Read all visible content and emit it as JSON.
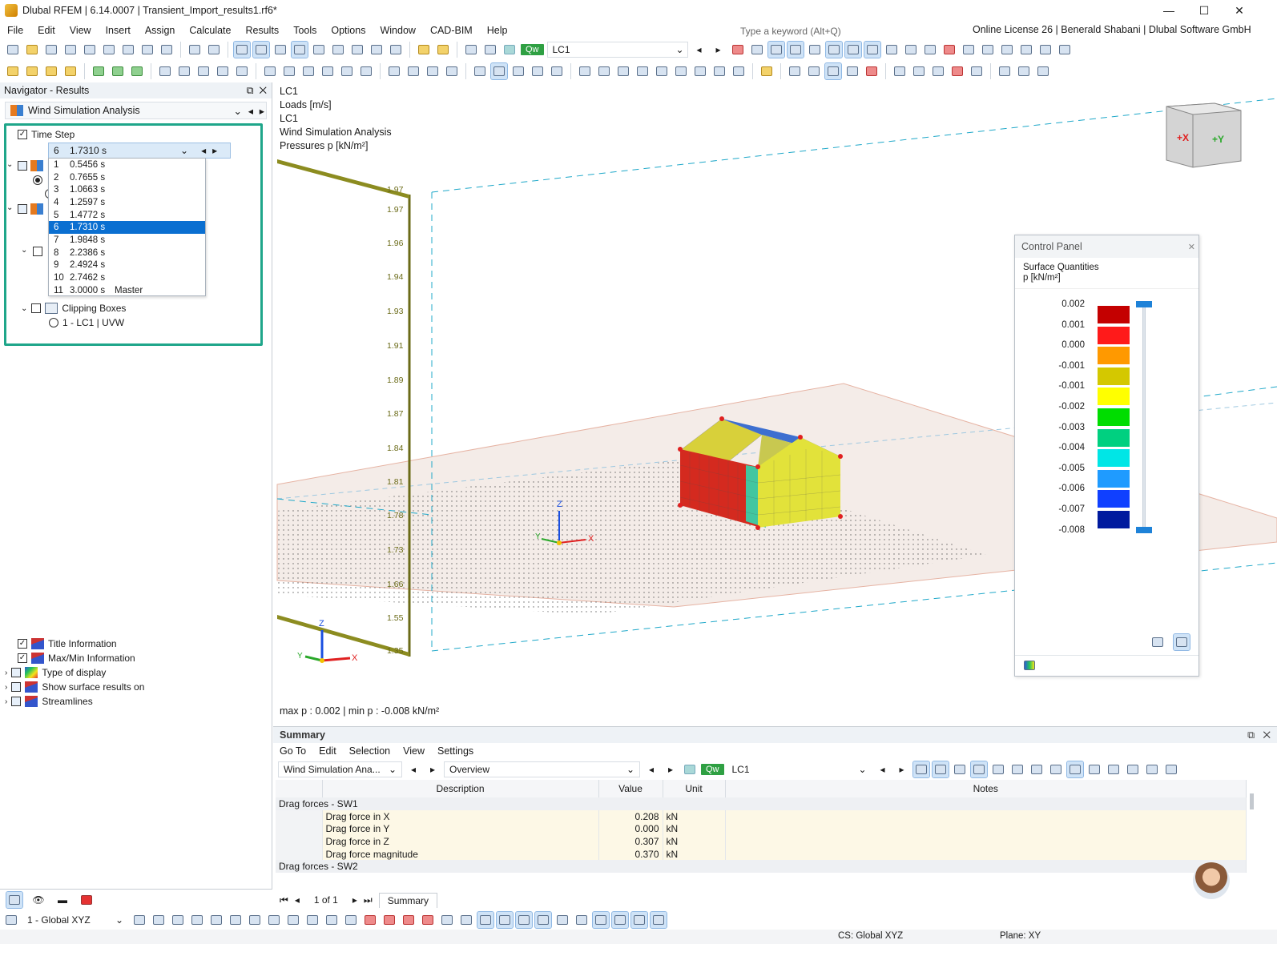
{
  "window": {
    "title": "Dlubal RFEM | 6.14.0007 | Transient_Import_results1.rf6*",
    "minimize": "—",
    "maximize": "☐",
    "close": "✕"
  },
  "menu": [
    "File",
    "Edit",
    "View",
    "Insert",
    "Assign",
    "Calculate",
    "Results",
    "Tools",
    "Options",
    "Window",
    "CAD-BIM",
    "Help"
  ],
  "search": {
    "placeholder": "Type a keyword (Alt+Q)"
  },
  "license": "Online License 26 | Benerald Shabani | Dlubal Software GmbH",
  "loadcase": {
    "tag": "Qw",
    "name": "LC1"
  },
  "navigator": {
    "title": "Navigator - Results",
    "module": "Wind Simulation Analysis",
    "time_step_label": "Time Step",
    "selected_step": {
      "n": "6",
      "v": "1.7310 s"
    },
    "steps": [
      {
        "n": "1",
        "v": "0.5456 s",
        "note": ""
      },
      {
        "n": "2",
        "v": "0.7655 s",
        "note": ""
      },
      {
        "n": "3",
        "v": "1.0663 s",
        "note": ""
      },
      {
        "n": "4",
        "v": "1.2597 s",
        "note": ""
      },
      {
        "n": "5",
        "v": "1.4772 s",
        "note": ""
      },
      {
        "n": "6",
        "v": "1.7310 s",
        "note": ""
      },
      {
        "n": "7",
        "v": "1.9848 s",
        "note": ""
      },
      {
        "n": "8",
        "v": "2.2386 s",
        "note": ""
      },
      {
        "n": "9",
        "v": "2.4924 s",
        "note": ""
      },
      {
        "n": "10",
        "v": "2.7462 s",
        "note": ""
      },
      {
        "n": "11",
        "v": "3.0000 s",
        "note": "Master"
      }
    ],
    "selected_index": 5,
    "clipping_boxes": "Clipping Boxes",
    "clipping_item": "1 - LC1 | UVW",
    "bottom_items": [
      "Title Information",
      "Max/Min Information",
      "Type of display",
      "Show surface results on",
      "Streamlines"
    ],
    "bottom_checked": [
      true,
      true,
      false,
      false,
      false
    ]
  },
  "view": {
    "info": [
      "LC1",
      "Loads [m/s]",
      "LC1",
      "Wind Simulation Analysis",
      "Pressures p [kN/m²]"
    ],
    "ruler_labels": [
      "1.97",
      "1.97",
      "1.96",
      "1.94",
      "1.93",
      "1.91",
      "1.89",
      "1.87",
      "1.84",
      "1.81",
      "1.78",
      "1.73",
      "1.66",
      "1.55",
      "1.35"
    ],
    "maxmin": "max p : 0.002 | min p : -0.008 kN/m²",
    "axis_x": "X",
    "axis_y": "Y",
    "axis_z": "Z",
    "cube_x": "+X",
    "cube_y": "+Y"
  },
  "control_panel": {
    "title": "Control Panel",
    "heading1": "Surface Quantities",
    "heading2": "p [kN/m²]",
    "values": [
      "0.002",
      "0.001",
      "0.000",
      "-0.001",
      "-0.001",
      "-0.002",
      "-0.003",
      "-0.004",
      "-0.005",
      "-0.006",
      "-0.007",
      "-0.008"
    ],
    "colors": [
      "#c40000",
      "#ff1a1a",
      "#ff9900",
      "#d4c800",
      "#ffff00",
      "#00dd00",
      "#00d080",
      "#00e6e6",
      "#1f9bff",
      "#1040ff",
      "#001a9e"
    ]
  },
  "summary": {
    "title": "Summary",
    "menu": [
      "Go To",
      "Edit",
      "Selection",
      "View",
      "Settings"
    ],
    "module": "Wind Simulation Ana...",
    "view": "Overview",
    "columns": [
      "Description",
      "Value",
      "Unit",
      "Notes"
    ],
    "groups": [
      {
        "title": "Drag forces - SW1",
        "rows": [
          {
            "d": "Drag force in X",
            "v": "0.208",
            "u": "kN"
          },
          {
            "d": "Drag force in Y",
            "v": "0.000",
            "u": "kN"
          },
          {
            "d": "Drag force in Z",
            "v": "0.307",
            "u": "kN"
          },
          {
            "d": "Drag force magnitude",
            "v": "0.370",
            "u": "kN"
          }
        ]
      },
      {
        "title": "Drag forces - SW2",
        "rows": []
      }
    ],
    "pager": "1 of 1",
    "tab": "Summary"
  },
  "status": {
    "cs_combo": "1 - Global XYZ",
    "cs": "CS: Global XYZ",
    "plane": "Plane: XY"
  }
}
